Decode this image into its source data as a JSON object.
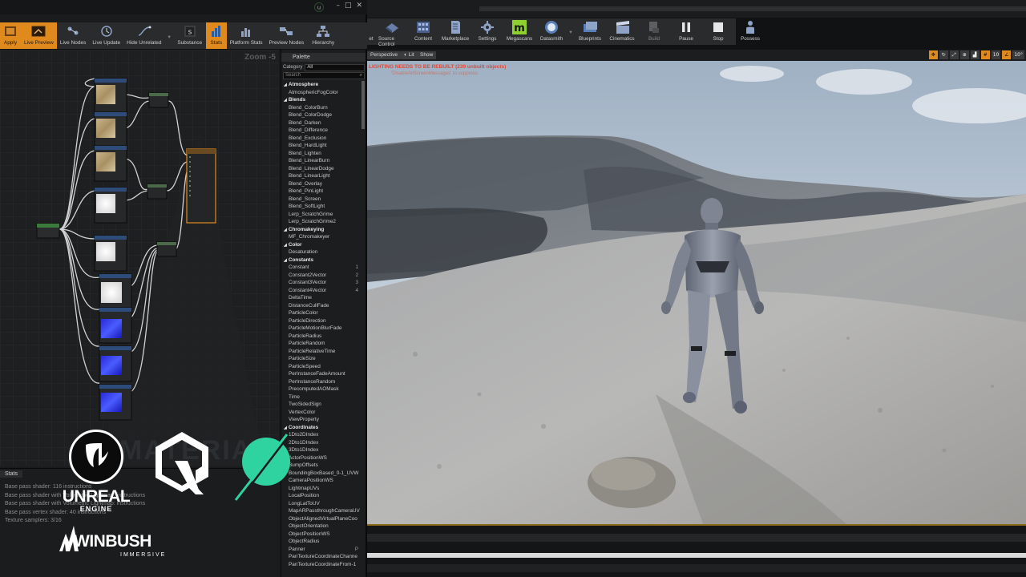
{
  "material_editor": {
    "toolbar": [
      {
        "label": "Apply",
        "icon": "apply-icon"
      },
      {
        "label": "Live Preview",
        "icon": "live-preview-icon"
      },
      {
        "label": "Live Nodes",
        "icon": "live-nodes-icon"
      },
      {
        "label": "Live Update",
        "icon": "live-update-icon"
      },
      {
        "label": "Hide Unrelated",
        "icon": "hide-unrelated-icon"
      },
      {
        "label": "Substance",
        "icon": "substance-icon"
      },
      {
        "label": "Stats",
        "icon": "stats-icon"
      },
      {
        "label": "Platform Stats",
        "icon": "platform-stats-icon"
      },
      {
        "label": "Preview Nodes",
        "icon": "preview-nodes-icon"
      },
      {
        "label": "Hierarchy",
        "icon": "hierarchy-icon"
      }
    ],
    "zoom_label": "Zoom -5",
    "graph_watermark": "MATERIAL",
    "stats": {
      "tab_label": "Stats",
      "lines": [
        "Base pass shader: 116 instructions",
        "Base pass shader with Volumetric Lightmap: instructions",
        "Base pass shader with Volumetric Lightmap: instructions",
        "Base pass vertex shader: 40 instructions",
        "Texture samplers: 3/16"
      ]
    },
    "palette": {
      "tab_label": "Palette",
      "category_label": "Category",
      "category_value": "All",
      "search_placeholder": "Search",
      "rows": [
        {
          "text": "Atmosphere",
          "header": true
        },
        {
          "text": "AtmosphericFogColor"
        },
        {
          "text": "Blends",
          "header": true
        },
        {
          "text": "Blend_ColorBurn"
        },
        {
          "text": "Blend_ColorDodge"
        },
        {
          "text": "Blend_Darken"
        },
        {
          "text": "Blend_Difference"
        },
        {
          "text": "Blend_Exclusion"
        },
        {
          "text": "Blend_HardLight"
        },
        {
          "text": "Blend_Lighten"
        },
        {
          "text": "Blend_LinearBurn"
        },
        {
          "text": "Blend_LinearDodge"
        },
        {
          "text": "Blend_LinearLight"
        },
        {
          "text": "Blend_Overlay"
        },
        {
          "text": "Blend_PinLight"
        },
        {
          "text": "Blend_Screen"
        },
        {
          "text": "Blend_SoftLight"
        },
        {
          "text": "Lerp_ScratchGrime"
        },
        {
          "text": "Lerp_ScratchGrime2"
        },
        {
          "text": "Chromakeying",
          "header": true
        },
        {
          "text": "MF_Chromakeyer"
        },
        {
          "text": "Color",
          "header": true
        },
        {
          "text": "Desaturation"
        },
        {
          "text": "Constants",
          "header": true
        },
        {
          "text": "Constant",
          "key": "1"
        },
        {
          "text": "Constant2Vector",
          "key": "2"
        },
        {
          "text": "Constant3Vector",
          "key": "3"
        },
        {
          "text": "Constant4Vector",
          "key": "4"
        },
        {
          "text": "DeltaTime"
        },
        {
          "text": "DistanceCullFade"
        },
        {
          "text": "ParticleColor"
        },
        {
          "text": "ParticleDirection"
        },
        {
          "text": "ParticleMotionBlurFade"
        },
        {
          "text": "ParticleRadius"
        },
        {
          "text": "ParticleRandom"
        },
        {
          "text": "ParticleRelativeTime"
        },
        {
          "text": "ParticleSize"
        },
        {
          "text": "ParticleSpeed"
        },
        {
          "text": "PerInstanceFadeAmount"
        },
        {
          "text": "PerInstanceRandom"
        },
        {
          "text": "PrecomputedAOMask"
        },
        {
          "text": "Time"
        },
        {
          "text": "TwoSidedSign"
        },
        {
          "text": "VertexColor"
        },
        {
          "text": "ViewProperty"
        },
        {
          "text": "Coordinates",
          "header": true
        },
        {
          "text": "1Dto2DIndex"
        },
        {
          "text": "2Dto1DIndex"
        },
        {
          "text": "3Dto1DIndex"
        },
        {
          "text": "ActorPositionWS"
        },
        {
          "text": "BumpOffsets"
        },
        {
          "text": "BoundingBoxBased_0-1_UVW"
        },
        {
          "text": "CameraPositionWS"
        },
        {
          "text": "LightmapUVs"
        },
        {
          "text": "LocalPosition"
        },
        {
          "text": "LongLatToUV"
        },
        {
          "text": "MapARPassthroughCameraUV"
        },
        {
          "text": "ObjectAlignedVirtualPlaneCoo"
        },
        {
          "text": "ObjectOrientation"
        },
        {
          "text": "ObjectPositionWS"
        },
        {
          "text": "ObjectRadius"
        },
        {
          "text": "Panner",
          "key": "P"
        },
        {
          "text": "PanTextureCoordinateChanne"
        },
        {
          "text": "PanTextureCoordinateFrom-1"
        }
      ]
    }
  },
  "level_editor": {
    "toolbar": [
      {
        "label": "Source Control",
        "icon": "source-control-icon"
      },
      {
        "label": "Content",
        "icon": "content-icon"
      },
      {
        "label": "Marketplace",
        "icon": "marketplace-icon"
      },
      {
        "label": "Settings",
        "icon": "settings-icon"
      },
      {
        "label": "Megascans",
        "icon": "megascans-icon"
      },
      {
        "label": "Datasmith",
        "icon": "datasmith-icon"
      },
      {
        "label": "Blueprints",
        "icon": "blueprints-icon"
      },
      {
        "label": "Cinematics",
        "icon": "cinematics-icon"
      },
      {
        "label": "Build",
        "icon": "build-icon"
      },
      {
        "label": "Pause",
        "icon": "pause-icon"
      },
      {
        "label": "Stop",
        "icon": "stop-icon"
      },
      {
        "label": "Possess",
        "icon": "possess-icon"
      }
    ],
    "viewport": {
      "perspective_label": "Perspective",
      "lit_label": "Lit",
      "show_label": "Show",
      "warning": "LIGHTING NEEDS TO BE REBUILT (239 unbuilt objects)",
      "warning_hint": "'DisableAllScreenMessages' to suppress",
      "grid_snap": "10",
      "rotation_snap": "10°",
      "accent_color": "#e08a1e"
    }
  },
  "logos": {
    "unreal_line1": "UNREAL",
    "unreal_line2": "ENGINE",
    "winbush_line1": "WINBUSH",
    "winbush_line2": "IMMERSIVE"
  }
}
